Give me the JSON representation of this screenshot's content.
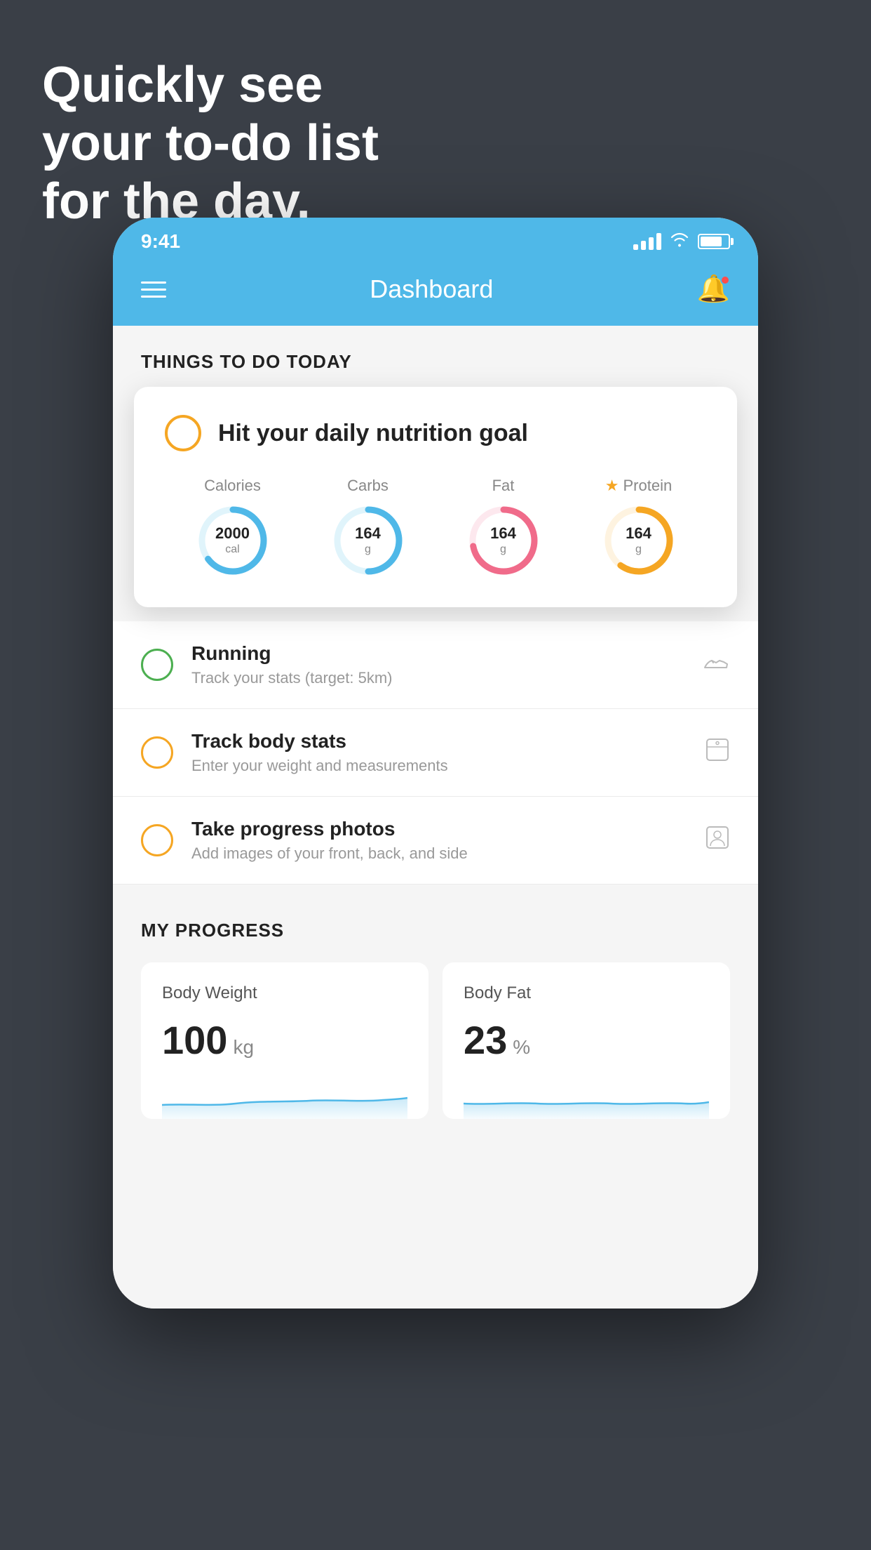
{
  "headline": {
    "line1": "Quickly see",
    "line2": "your to-do list",
    "line3": "for the day."
  },
  "status_bar": {
    "time": "9:41",
    "signal_bars": [
      8,
      13,
      18,
      24
    ],
    "wifi": "wifi",
    "battery": 80
  },
  "header": {
    "title": "Dashboard",
    "menu_icon": "hamburger",
    "notification_icon": "bell"
  },
  "things_to_do": {
    "section_title": "THINGS TO DO TODAY",
    "nutrition_card": {
      "title": "Hit your daily nutrition goal",
      "macros": [
        {
          "label": "Calories",
          "value": "2000",
          "unit": "cal",
          "color": "#4fb8e8",
          "track_color": "#e0f4fb",
          "progress": 0.65,
          "star": false
        },
        {
          "label": "Carbs",
          "value": "164",
          "unit": "g",
          "color": "#4fb8e8",
          "track_color": "#e0f4fb",
          "progress": 0.5,
          "star": false
        },
        {
          "label": "Fat",
          "value": "164",
          "unit": "g",
          "color": "#f06b8a",
          "track_color": "#fde8ee",
          "progress": 0.72,
          "star": false
        },
        {
          "label": "Protein",
          "value": "164",
          "unit": "g",
          "color": "#f5a623",
          "track_color": "#fef3e0",
          "progress": 0.6,
          "star": true
        }
      ]
    },
    "items": [
      {
        "id": "running",
        "title": "Running",
        "subtitle": "Track your stats (target: 5km)",
        "circle_color": "green",
        "icon": "shoe"
      },
      {
        "id": "body-stats",
        "title": "Track body stats",
        "subtitle": "Enter your weight and measurements",
        "circle_color": "yellow",
        "icon": "scale"
      },
      {
        "id": "progress-photos",
        "title": "Take progress photos",
        "subtitle": "Add images of your front, back, and side",
        "circle_color": "yellow",
        "icon": "portrait"
      }
    ]
  },
  "my_progress": {
    "section_title": "MY PROGRESS",
    "cards": [
      {
        "title": "Body Weight",
        "value": "100",
        "unit": "kg"
      },
      {
        "title": "Body Fat",
        "value": "23",
        "unit": "%"
      }
    ]
  }
}
